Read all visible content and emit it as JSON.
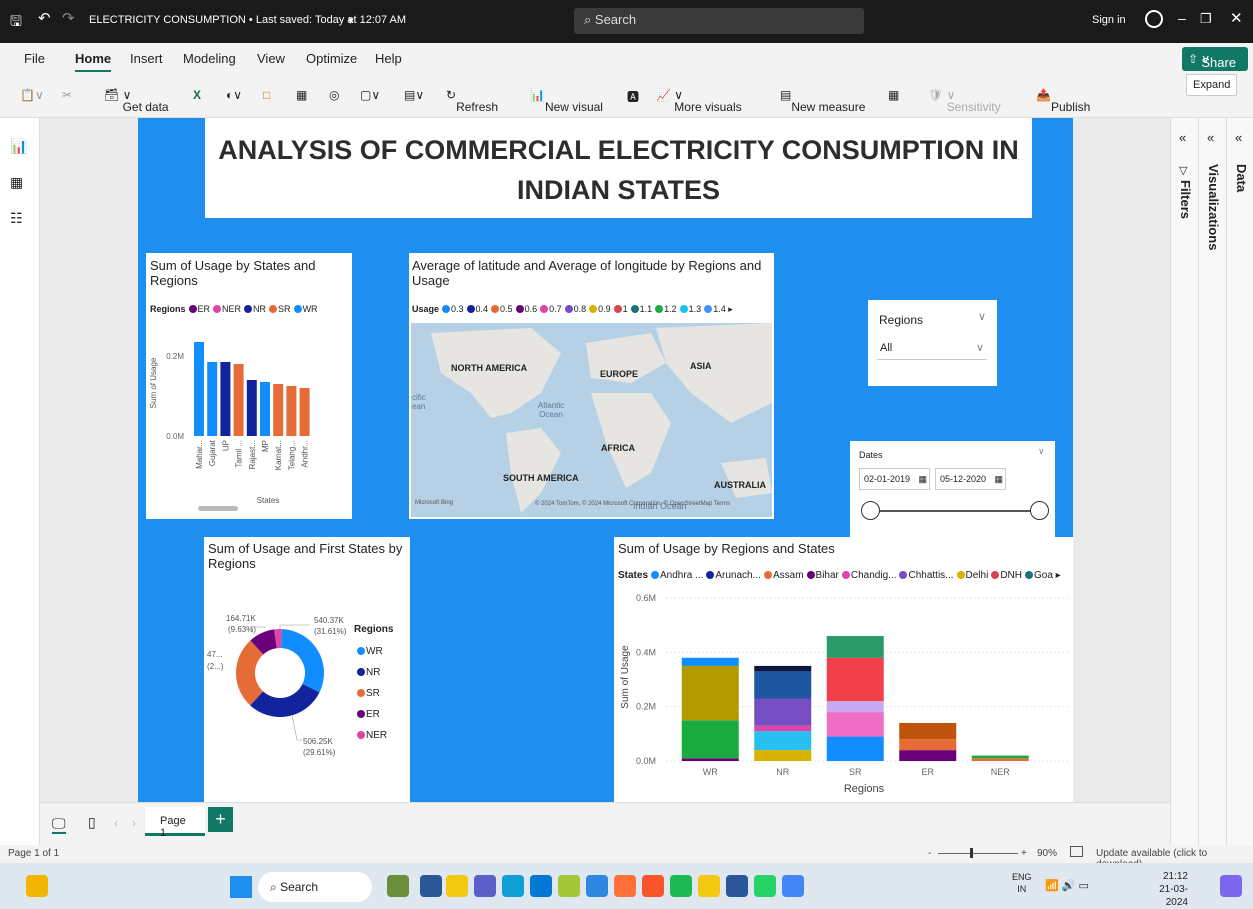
{
  "titlebar": {
    "doc": "ELECTRICITY CONSUMPTION • Last saved: Today at 12:07 AM",
    "search": "Search",
    "signin": "Sign in"
  },
  "menu": {
    "file": "File",
    "home": "Home",
    "insert": "Insert",
    "modeling": "Modeling",
    "view": "View",
    "optimize": "Optimize",
    "help": "Help",
    "share": "Share"
  },
  "ribbon": {
    "get_data": "Get data",
    "refresh": "Refresh",
    "new_visual": "New visual",
    "more_visuals": "More visuals",
    "new_measure": "New measure",
    "sensitivity": "Sensitivity",
    "publish": "Publish",
    "expand": "Expand"
  },
  "report": {
    "title_line1": "ANALYSIS OF  COMMERCIAL ELECTRICITY CONSUMPTION IN",
    "title_line2": "INDIAN STATES"
  },
  "bar1": {
    "title": "Sum of Usage by States and Regions",
    "legend_label": "Regions",
    "legend": [
      {
        "n": "ER",
        "c": "#6b007b"
      },
      {
        "n": "NER",
        "c": "#e044a7"
      },
      {
        "n": "NR",
        "c": "#12239e"
      },
      {
        "n": "SR",
        "c": "#e66c37"
      },
      {
        "n": "WR",
        "c": "#118dff"
      }
    ],
    "ylabel": "Sum of Usage",
    "xlabel": "States",
    "yticks": [
      "0.2M",
      "0.0M"
    ]
  },
  "map": {
    "title": "Average of latitude and Average of longitude by Regions and Usage",
    "legend_label": "Usage",
    "legend": [
      "0.3",
      "0.4",
      "0.5",
      "0.6",
      "0.7",
      "0.8",
      "0.9",
      "1",
      "1.1",
      "1.2",
      "1.3",
      "1.4"
    ],
    "labels": {
      "na": "NORTH AMERICA",
      "eu": "EUROPE",
      "asia": "ASIA",
      "atl": "Atlantic Ocean",
      "pac": "cific ean",
      "af": "AFRICA",
      "sa": "SOUTH AMERICA",
      "au": "AUSTRALIA",
      "io": "Indian Ocean",
      "bing": "Microsoft Bing",
      "credit": "© 2024 TomTom, © 2024 Microsoft Corporation, © OpenStreetMap  Terms"
    }
  },
  "slicer_regions": {
    "title": "Regions",
    "value": "All"
  },
  "slicer_dates": {
    "title": "Dates",
    "from": "02-01-2019",
    "to": "05-12-2020"
  },
  "donut": {
    "title": "Sum of Usage and First States by Regions",
    "legend_label": "Regions",
    "legend": [
      "WR",
      "NR",
      "SR",
      "ER",
      "NER"
    ],
    "labels": {
      "wr": "540.37K",
      "wr_pct": "(31.61%)",
      "nr": "506.25K",
      "nr_pct": "(29.61%)",
      "er": "164.71K",
      "er_pct": "(9.63%)",
      "ner": "47...",
      "ner_pct": "(2...)"
    }
  },
  "stacked": {
    "title": "Sum of Usage by Regions and States",
    "legend_label": "States",
    "legend": [
      {
        "n": "Andhra ...",
        "c": "#118dff"
      },
      {
        "n": "Arunach...",
        "c": "#12239e"
      },
      {
        "n": "Assam",
        "c": "#e66c37"
      },
      {
        "n": "Bihar",
        "c": "#6b007b"
      },
      {
        "n": "Chandig...",
        "c": "#e044a7"
      },
      {
        "n": "Chhattis...",
        "c": "#744ec2"
      },
      {
        "n": "Delhi",
        "c": "#d9b300"
      },
      {
        "n": "DNH",
        "c": "#d64550"
      },
      {
        "n": "Goa",
        "c": "#197278"
      }
    ],
    "ylabel": "Sum of Usage",
    "xlabel": "Regions",
    "yticks": [
      "0.6M",
      "0.4M",
      "0.2M",
      "0.0M"
    ],
    "categories": [
      "WR",
      "NR",
      "SR",
      "ER",
      "NER"
    ]
  },
  "chart_data": [
    {
      "type": "bar",
      "title": "Sum of Usage by States and Regions",
      "xlabel": "States",
      "ylabel": "Sum of Usage",
      "ylim": [
        0,
        0.27
      ],
      "categories": [
        "Mahar...",
        "Gujarat",
        "UP",
        "Tamil ...",
        "Rajast...",
        "MP",
        "Karnat...",
        "Telang...",
        "Andhr..."
      ],
      "values": [
        0.235,
        0.185,
        0.185,
        0.18,
        0.14,
        0.135,
        0.13,
        0.125,
        0.12
      ],
      "colors": [
        "#118dff",
        "#118dff",
        "#12239e",
        "#e66c37",
        "#12239e",
        "#118dff",
        "#e66c37",
        "#e66c37",
        "#e66c37"
      ]
    },
    {
      "type": "pie",
      "title": "Sum of Usage and First States by Regions",
      "slices": [
        {
          "name": "WR",
          "value": 540.37,
          "color": "#118dff"
        },
        {
          "name": "NR",
          "value": 506.25,
          "color": "#12239e"
        },
        {
          "name": "SR",
          "value": 451.3,
          "color": "#e66c37"
        },
        {
          "name": "ER",
          "value": 164.71,
          "color": "#6b007b"
        },
        {
          "name": "NER",
          "value": 47,
          "color": "#e044a7"
        }
      ]
    },
    {
      "type": "bar",
      "title": "Sum of Usage by Regions and States",
      "xlabel": "Regions",
      "ylabel": "Sum of Usage",
      "ylim": [
        0,
        0.65
      ],
      "categories": [
        "WR",
        "NR",
        "SR",
        "ER",
        "NER"
      ],
      "stacks": [
        [
          {
            "v": 0.01,
            "c": "#6b007b"
          },
          {
            "v": 0.14,
            "c": "#1aab40"
          },
          {
            "v": 0.2,
            "c": "#b39a00"
          },
          {
            "v": 0.03,
            "c": "#118dff"
          }
        ],
        [
          {
            "v": 0.04,
            "c": "#d9b300"
          },
          {
            "v": 0.07,
            "c": "#29c0f1"
          },
          {
            "v": 0.02,
            "c": "#e044a7"
          },
          {
            "v": 0.1,
            "c": "#744ec2"
          },
          {
            "v": 0.1,
            "c": "#1e56a0"
          },
          {
            "v": 0.02,
            "c": "#0b1540"
          }
        ],
        [
          {
            "v": 0.09,
            "c": "#118dff"
          },
          {
            "v": 0.09,
            "c": "#ee6ec4"
          },
          {
            "v": 0.04,
            "c": "#c9a9f2"
          },
          {
            "v": 0.16,
            "c": "#f2404b"
          },
          {
            "v": 0.08,
            "c": "#2a9a6a"
          }
        ],
        [
          {
            "v": 0.04,
            "c": "#6b007b"
          },
          {
            "v": 0.04,
            "c": "#e66c37"
          },
          {
            "v": 0.06,
            "c": "#c0540d"
          }
        ],
        [
          {
            "v": 0.01,
            "c": "#e66c37"
          },
          {
            "v": 0.01,
            "c": "#1aab40"
          }
        ]
      ]
    }
  ],
  "pagebar": {
    "page": "Page 1",
    "status": "Page 1 of 1",
    "zoom": "90%",
    "update": "Update available (click to download)"
  },
  "panels": {
    "filters": "Filters",
    "visualizations": "Visualizations",
    "data": "Data"
  },
  "taskbar": {
    "search": "Search",
    "lang1": "ENG",
    "lang2": "IN",
    "time": "21:12",
    "date": "21-03-2024"
  }
}
